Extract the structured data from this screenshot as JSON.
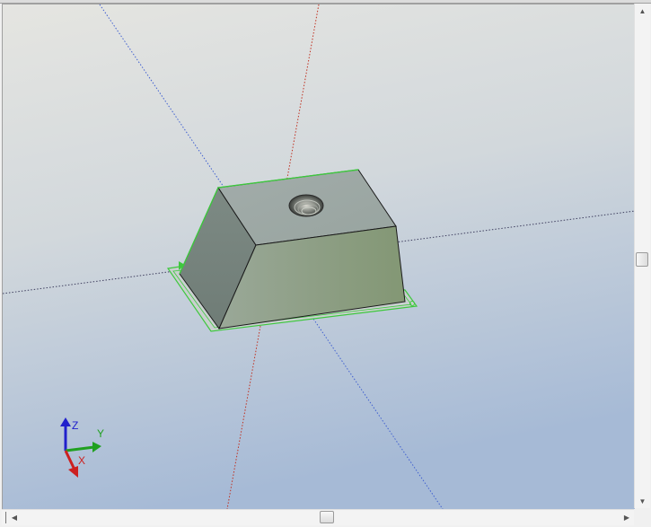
{
  "viewport": {
    "background_top": "#e4e4e0",
    "background_bottom": "#a8bcd8"
  },
  "triad": {
    "z_label": "Z",
    "y_label": "Y",
    "x_label": "X",
    "x_color": "#cc2020",
    "y_color": "#20a020",
    "z_color": "#2020cc"
  },
  "model": {
    "highlight_color": "#3ec83e",
    "face_color": "#8fa08a"
  },
  "icons": {
    "scroll_up": "▲",
    "scroll_down": "▼",
    "scroll_left": "◀",
    "scroll_right": "▶"
  }
}
